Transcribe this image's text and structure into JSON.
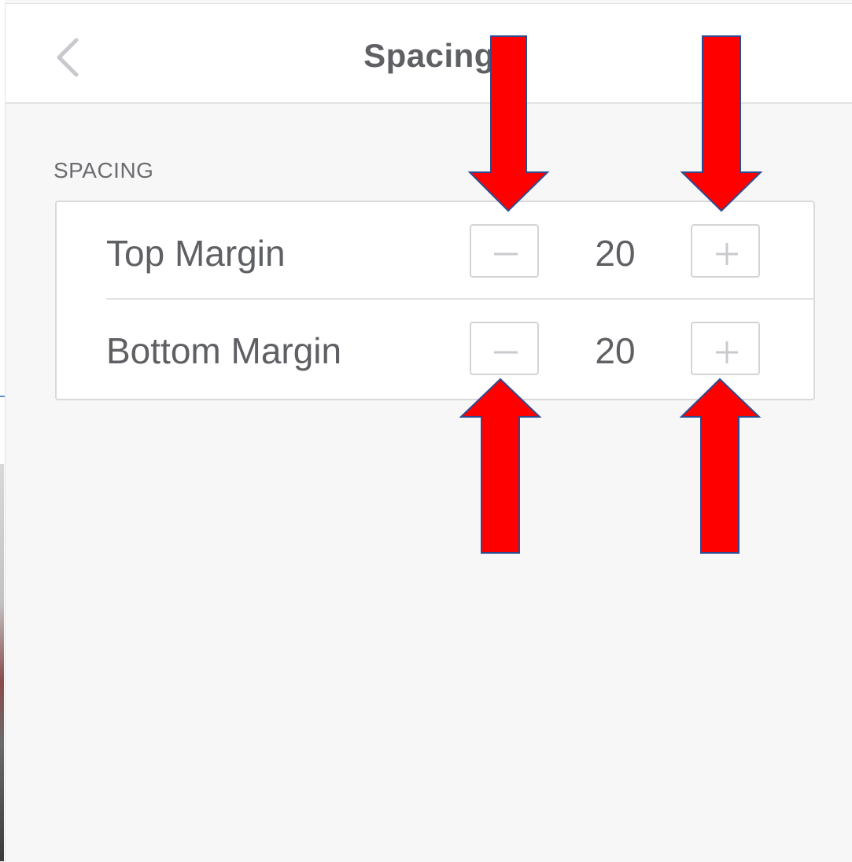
{
  "header": {
    "title": "Spacing",
    "back_icon": "chevron-left-icon"
  },
  "section": {
    "label": "SPACING"
  },
  "rows": [
    {
      "label": "Top Margin",
      "value": "20",
      "decrement_icon": "minus-icon",
      "increment_icon": "plus-icon"
    },
    {
      "label": "Bottom Margin",
      "value": "20",
      "decrement_icon": "minus-icon",
      "increment_icon": "plus-icon"
    }
  ],
  "colors": {
    "annotation_arrow_fill": "#ff0000",
    "annotation_arrow_stroke": "#2f4b8f",
    "text": "#5f6064",
    "disabled_glyph": "#c9cacd",
    "panel_background": "#f7f7f8"
  }
}
